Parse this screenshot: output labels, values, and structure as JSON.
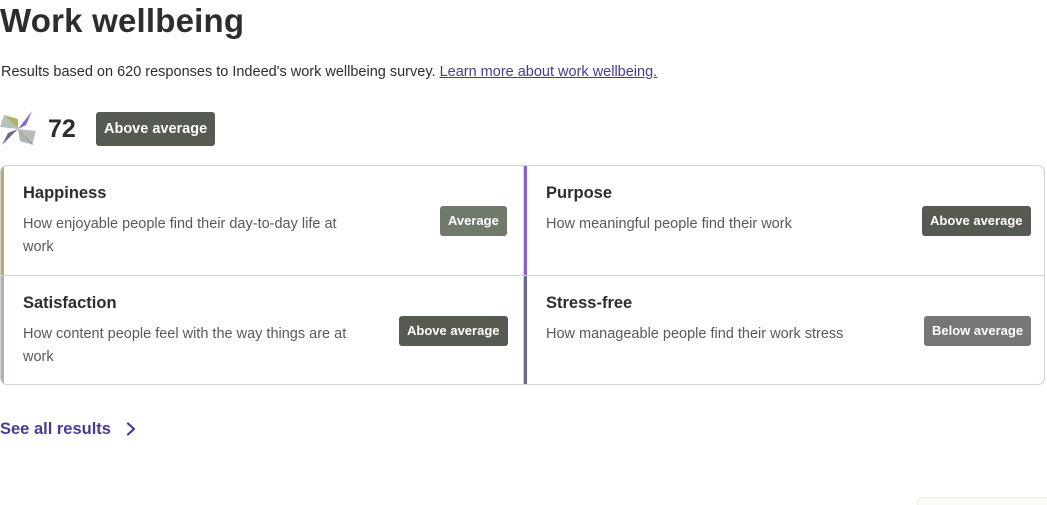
{
  "header": {
    "title": "Work wellbeing",
    "subtitle_text": "Results based on 620 responses to Indeed's work wellbeing survey. ",
    "learn_more_link": "Learn more about work wellbeing."
  },
  "score": {
    "value": "72",
    "rating": "Above average"
  },
  "dimensions": [
    {
      "name": "Happiness",
      "description": "How enjoyable people find their day-to-day life at work",
      "rating": "Average",
      "accent_color": "#b3b06a"
    },
    {
      "name": "Purpose",
      "description": "How meaningful people find their work",
      "rating": "Above average",
      "accent_color": "#8a63d2"
    },
    {
      "name": "Satisfaction",
      "description": "How content people feel with the way things are at work",
      "rating": "Above average",
      "accent_color": "#a7b8ad"
    },
    {
      "name": "Stress-free",
      "description": "How manageable people find their work stress",
      "rating": "Below average",
      "accent_color": "#6b6a86"
    }
  ],
  "footer": {
    "see_all_label": "See all results"
  },
  "icons": {
    "logo": "wellbeing-pinwheel-icon",
    "see_all_chevron": "chevron-right-icon"
  }
}
